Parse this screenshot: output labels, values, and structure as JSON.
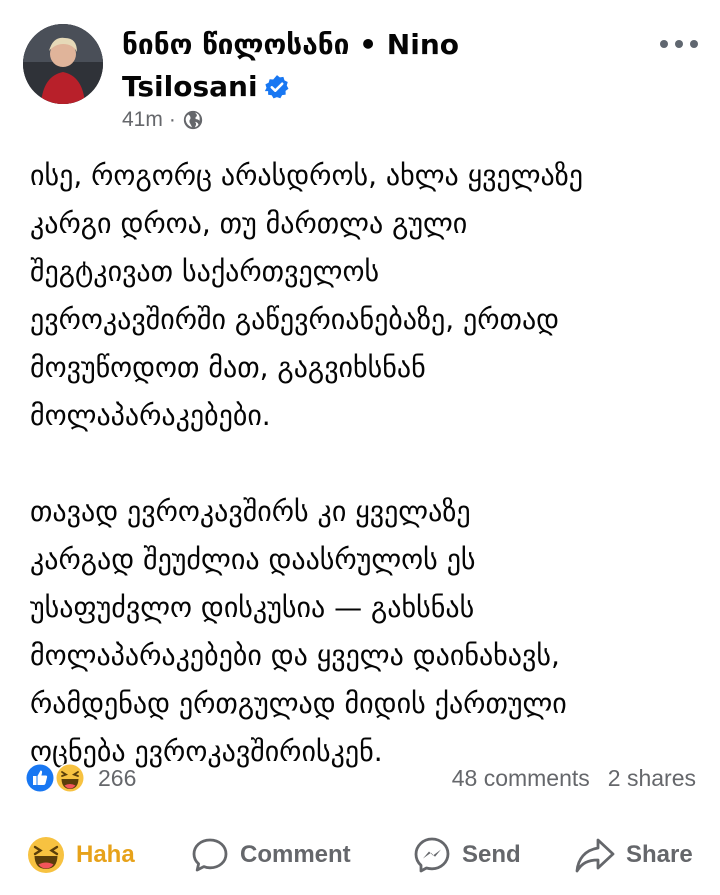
{
  "post": {
    "author": "ნინო წილოსანი • Nino Tsilosani",
    "time": "41m",
    "paragraphs": [
      [
        "ისე, როგორც არასდროს, ახლა ყველაზე",
        "კარგი დროა, თუ მართლა  გული",
        "შეგტკივათ საქართველოს",
        "ევროკავშირში გაწევრიანებაზე,  ერთად",
        "მოვუწოდოთ მათ, გაგვიხსნან",
        "მოლაპარაკებები."
      ],
      [
        "თავად ევროკავშირს კი ყველაზე",
        "კარგად შეუძლია დაასრულოს ეს",
        "უსაფუძვლო დისკუსია — გახსნას",
        "მოლაპარაკებები და ყველა დაინახავს,",
        "რამდენად ერთგულად მიდის ქართული",
        "ოცნება ევროკავშირისკენ."
      ]
    ]
  },
  "stats": {
    "reactions": "266",
    "comments": "48 comments",
    "shares": "2 shares"
  },
  "actions": {
    "haha": "Haha",
    "comment": "Comment",
    "send": "Send",
    "share": "Share"
  },
  "colors": {
    "haha_active": "#e7a21a",
    "verified": "#1877f2",
    "like_blue": "#1877f2",
    "secondary_text": "#65676b"
  },
  "icons": [
    "more-icon",
    "verified-icon",
    "globe-icon",
    "like-reaction-icon",
    "haha-reaction-icon",
    "haha-icon",
    "comment-icon",
    "messenger-icon",
    "share-icon"
  ]
}
